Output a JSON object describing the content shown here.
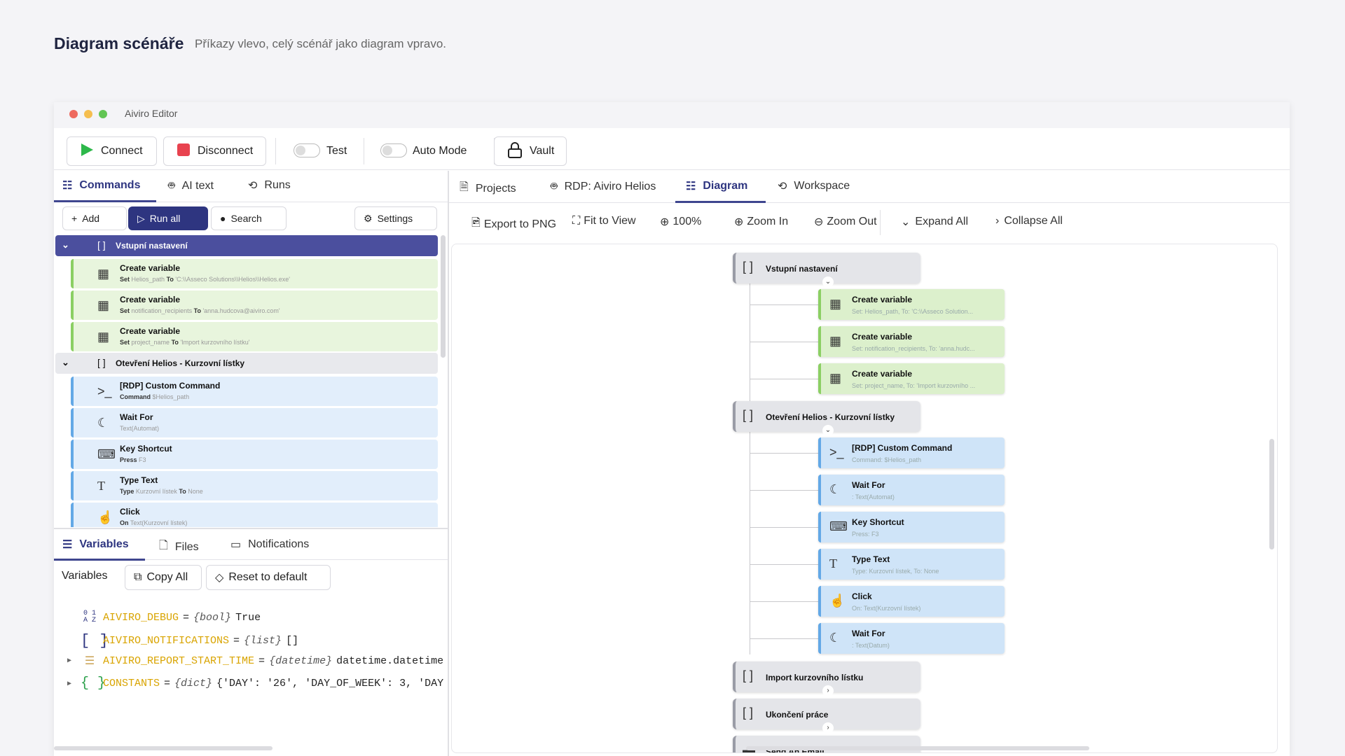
{
  "page": {
    "title": "Diagram scénáře",
    "subtitle": "Příkazy vlevo, celý scénář jako diagram vpravo."
  },
  "window": {
    "title": "Aiviro Editor"
  },
  "toolbar": {
    "connect": "Connect",
    "disconnect": "Disconnect",
    "test": "Test",
    "auto_mode": "Auto Mode",
    "vault": "Vault"
  },
  "left_tabs": {
    "commands": "Commands",
    "ai_text": "AI text",
    "runs": "Runs"
  },
  "cmd_toolbar": {
    "add": "Add",
    "run_all": "Run all",
    "search": "Search",
    "settings": "Settings"
  },
  "commands": {
    "group1": {
      "label": "Vstupní nastavení",
      "items": [
        {
          "title": "Create variable",
          "k1": "Set",
          "v1": "Helios_path",
          "k2": "To",
          "v2": "'C:\\\\Asseco Solutions\\\\Helios\\\\Helios.exe'"
        },
        {
          "title": "Create variable",
          "k1": "Set",
          "v1": "notification_recipients",
          "k2": "To",
          "v2": "'anna.hudcova@aiviro.com'"
        },
        {
          "title": "Create variable",
          "k1": "Set",
          "v1": "project_name",
          "k2": "To",
          "v2": "'Import kurzovního lístku'"
        }
      ]
    },
    "group2": {
      "label": "Otevření Helios - Kurzovní lístky",
      "items": [
        {
          "title": "[RDP] Custom Command",
          "k1": "Command",
          "v1": "$Helios_path"
        },
        {
          "title": "Wait For",
          "v1": "Text(Automat)"
        },
        {
          "title": "Key Shortcut",
          "k1": "Press",
          "v1": "F3"
        },
        {
          "title": "Type Text",
          "k1": "Type",
          "v1": "Kurzovní lístek",
          "k2": "To",
          "v2": "None"
        },
        {
          "title": "Click",
          "k1": "On",
          "v1": "Text(Kurzovní lístek)"
        }
      ]
    }
  },
  "bottom_tabs": {
    "variables": "Variables",
    "files": "Files",
    "notifications": "Notifications"
  },
  "var_toolbar": {
    "label": "Variables",
    "copy_all": "Copy All",
    "reset": "Reset to default"
  },
  "variables": [
    {
      "name": "AIVIRO_DEBUG",
      "eq": "=",
      "type": "{bool}",
      "value": "True"
    },
    {
      "name": "AIVIRO_NOTIFICATIONS",
      "eq": "=",
      "type": "{list}",
      "value": "[]"
    },
    {
      "name": "AIVIRO_REPORT_START_TIME",
      "eq": "=",
      "type": "{datetime}",
      "value": "datetime.datetime"
    },
    {
      "name": "CONSTANTS",
      "eq": "=",
      "type": "{dict}",
      "value": "{'DAY': '26', 'DAY_OF_WEEK': 3, 'DAY"
    }
  ],
  "right_tabs": {
    "projects": "Projects",
    "rdp": "RDP: Aiviro Helios",
    "diagram": "Diagram",
    "workspace": "Workspace"
  },
  "diagram_toolbar": {
    "export": "Export to PNG",
    "fit": "Fit to View",
    "zoom": "100%",
    "zoom_in": "Zoom In",
    "zoom_out": "Zoom Out",
    "expand": "Expand All",
    "collapse": "Collapse All"
  },
  "diagram": {
    "g1": {
      "label": "Vstupní nastavení",
      "nodes": [
        {
          "title": "Create variable",
          "sub": "Set: Helios_path, To: 'C:\\\\Asseco Solution..."
        },
        {
          "title": "Create variable",
          "sub": "Set: notification_recipients, To: 'anna.hudc..."
        },
        {
          "title": "Create variable",
          "sub": "Set: project_name, To: 'Import kurzovního ..."
        }
      ]
    },
    "g2": {
      "label": "Otevření Helios - Kurzovní lístky",
      "nodes": [
        {
          "title": "[RDP] Custom Command",
          "sub": "Command: $Helios_path"
        },
        {
          "title": "Wait For",
          "sub": ": Text(Automat)"
        },
        {
          "title": "Key Shortcut",
          "sub": "Press: F3"
        },
        {
          "title": "Type Text",
          "sub": "Type: Kurzovní lístek, To: None"
        },
        {
          "title": "Click",
          "sub": "On: Text(Kurzovní lístek)"
        },
        {
          "title": "Wait For",
          "sub": ": Text(Datum)"
        }
      ]
    },
    "g3": {
      "label": "Import kurzovního lístku"
    },
    "g4": {
      "label": "Ukončení práce"
    },
    "g5": {
      "label": "Send An Email"
    }
  },
  "colors": {
    "accent": "#3f468f",
    "green_node": "#dcf0cc",
    "blue_node": "#cfe4f8",
    "var_name": "#d9a400"
  }
}
